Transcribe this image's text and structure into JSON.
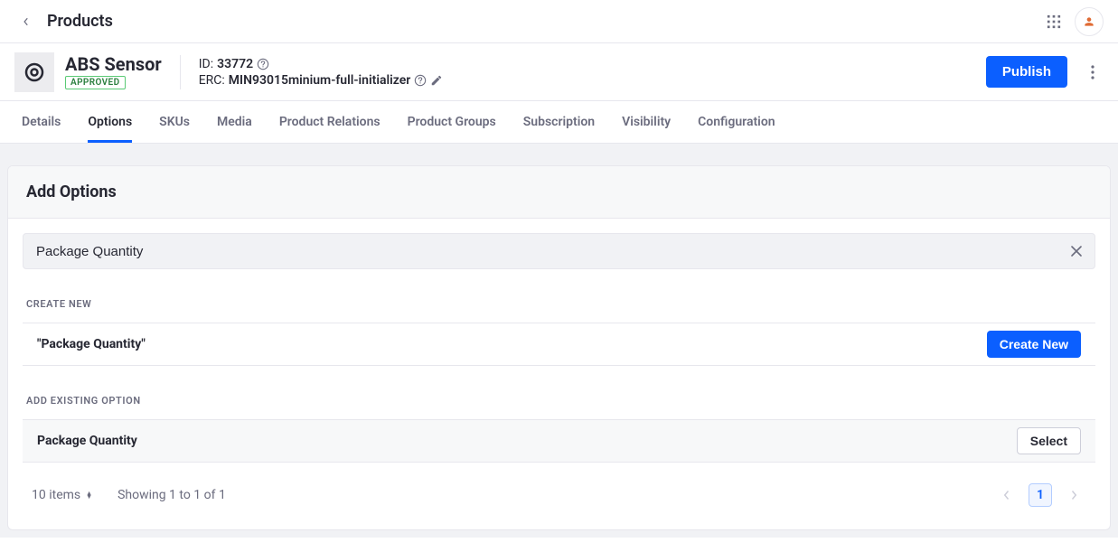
{
  "header": {
    "title": "Products"
  },
  "product": {
    "name": "ABS Sensor",
    "status_badge": "APPROVED",
    "id_label": "ID: ",
    "id_value": "33772",
    "erc_label": "ERC: ",
    "erc_value": "MIN93015minium-full-initializer"
  },
  "actions": {
    "publish": "Publish"
  },
  "tabs": {
    "details": "Details",
    "options": "Options",
    "skus": "SKUs",
    "media": "Media",
    "product_relations": "Product Relations",
    "product_groups": "Product Groups",
    "subscription": "Subscription",
    "visibility": "Visibility",
    "configuration": "Configuration"
  },
  "panel": {
    "title": "Add Options",
    "search_value": "Package Quantity",
    "create_section_label": "CREATE NEW",
    "create_row_name": "\"Package Quantity\"",
    "create_button": "Create New",
    "existing_section_label": "ADD EXISTING OPTION",
    "existing_row_name": "Package Quantity",
    "select_button": "Select"
  },
  "pager": {
    "per_page": "10 items",
    "summary": "Showing 1 to 1 of 1",
    "current": "1"
  }
}
